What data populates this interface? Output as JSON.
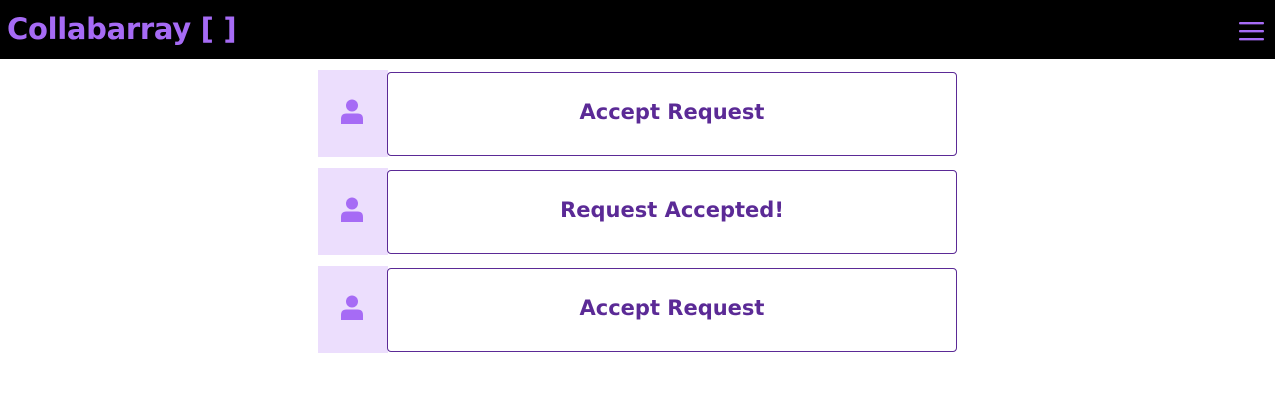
{
  "header": {
    "brand": "Collabarray [ ]",
    "menu_icon": "hamburger-menu-icon"
  },
  "requests": [
    {
      "avatar_icon": "user-icon",
      "button_label": "Accept Request"
    },
    {
      "avatar_icon": "user-icon",
      "button_label": "Request Accepted!"
    },
    {
      "avatar_icon": "user-icon",
      "button_label": "Accept Request"
    }
  ],
  "colors": {
    "navbar_bg": "#000000",
    "brand": "#a66bf5",
    "avatar_bg": "#ecdefd",
    "avatar_icon": "#a66bf5",
    "button_text": "#5b2a96",
    "button_border": "#5b2a96"
  }
}
